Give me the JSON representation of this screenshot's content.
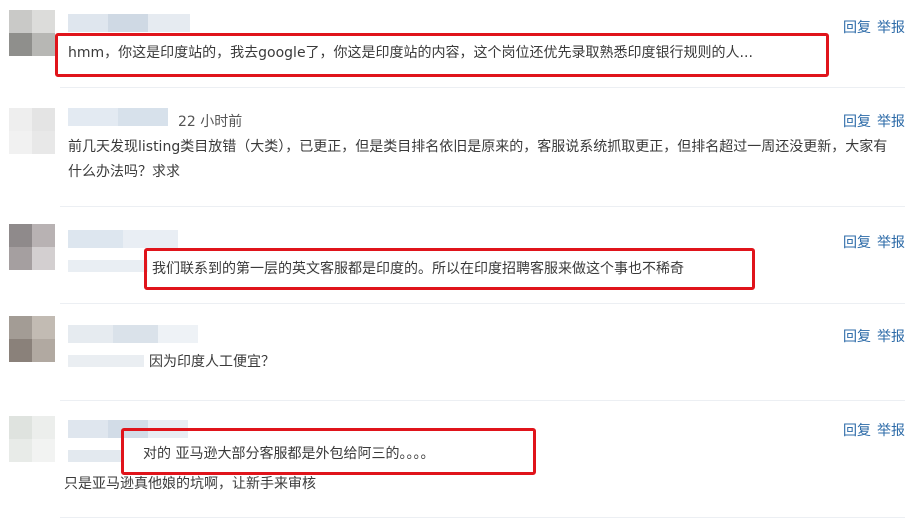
{
  "actions": {
    "reply": "回复",
    "report": "举报"
  },
  "comments": [
    {
      "text": "hmm，你这是印度站的，我去google了，你这是印度站的内容，这个岗位还优先录取熟悉印度银行规则的人..."
    },
    {
      "time": "22 小时前",
      "text": "前几天发现listing类目放错（大类），已更正，但是类目排名依旧是原来的，客服说系统抓取更正，但排名超过一周还没更新，大家有什么办法吗？求求"
    },
    {
      "text": "我们联系到的第一层的英文客服都是印度的。所以在印度招聘客服来做这个事也不稀奇"
    },
    {
      "text": "因为印度人工便宜？"
    },
    {
      "text": "对的 亚马逊大部分客服都是外包给阿三的。。。。",
      "text2": "只是亚马逊真他娘的坑啊，让新手来审核"
    }
  ],
  "colors": {
    "highlight": "#e0141b",
    "action_link": "#2d6ba8"
  }
}
